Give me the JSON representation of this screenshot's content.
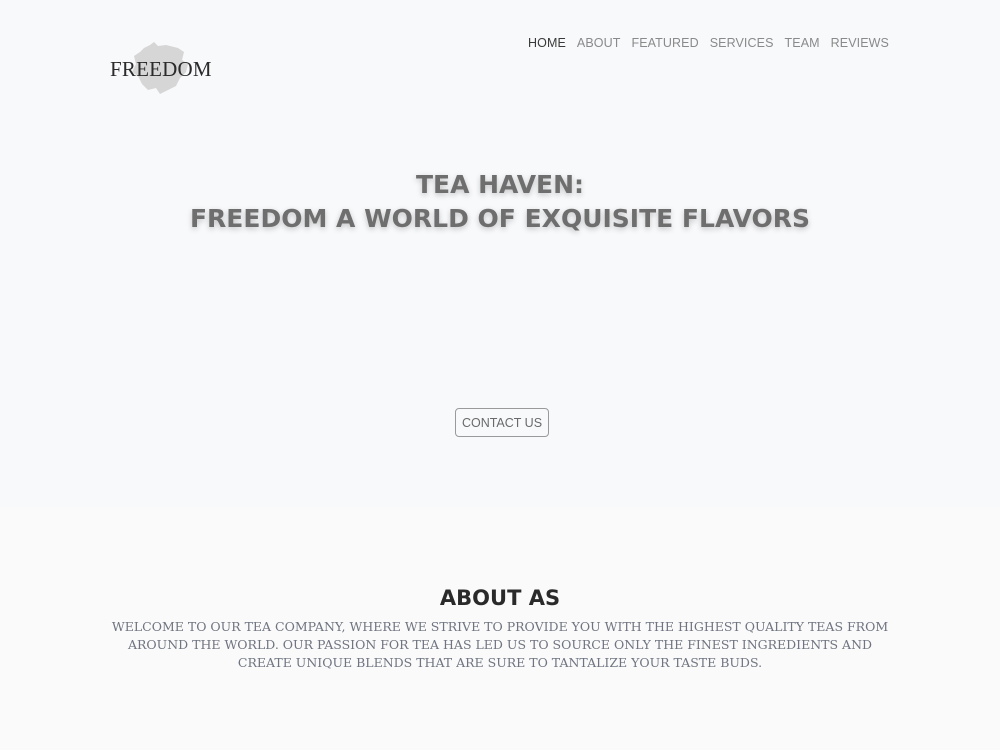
{
  "header": {
    "logo_text": "FREEDOM",
    "nav": [
      {
        "label": "HOME",
        "active": true
      },
      {
        "label": "ABOUT",
        "active": false
      },
      {
        "label": "FEATURED",
        "active": false
      },
      {
        "label": "SERVICES",
        "active": false
      },
      {
        "label": "TEAM",
        "active": false
      },
      {
        "label": "REVIEWS",
        "active": false
      }
    ]
  },
  "hero": {
    "title_line1": "TEA HAVEN:",
    "title_line2": "FREEDOM A WORLD OF EXQUISITE FLAVORS",
    "cta_label": "CONTACT US"
  },
  "about": {
    "title": "ABOUT AS",
    "text": "WELCOME TO OUR TEA COMPANY, WHERE WE STRIVE TO PROVIDE YOU WITH THE HIGHEST QUALITY TEAS FROM AROUND THE WORLD. OUR PASSION FOR TEA HAS LED US TO SOURCE ONLY THE FINEST INGREDIENTS AND CREATE UNIQUE BLENDS THAT ARE SURE TO TANTALIZE YOUR TASTE BUDS."
  },
  "colors": {
    "hero_bg": "#f8f9fb",
    "section_bg": "#fafafa",
    "nav_active": "#3a3a3a",
    "nav_inactive": "#8a8a8a",
    "logo_blob": "#d6d6d6"
  },
  "icons": {
    "logo_mark": "brush-splash-icon"
  }
}
